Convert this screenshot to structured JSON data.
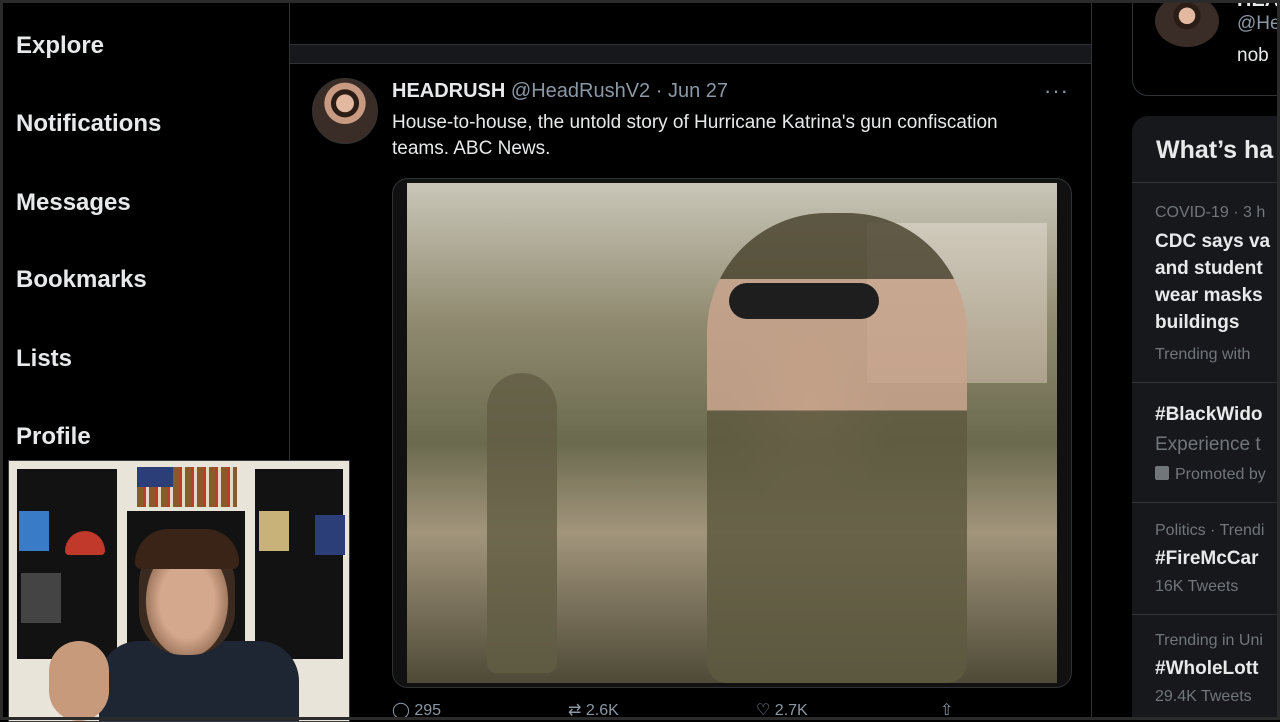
{
  "nav": {
    "items": [
      {
        "label": "Explore"
      },
      {
        "label": "Notifications"
      },
      {
        "label": "Messages"
      },
      {
        "label": "Bookmarks"
      },
      {
        "label": "Lists"
      },
      {
        "label": "Profile"
      }
    ]
  },
  "tweet": {
    "name": "HEADRUSH",
    "handle": "@HeadRushV2",
    "date": "· Jun 27",
    "more": "···",
    "text": "House-to-house, the untold story of Hurricane Katrina's gun confiscation teams. ABC News.",
    "actions": {
      "reply_count": "295",
      "retweet_count": "2.6K",
      "like_count": "2.7K"
    }
  },
  "right": {
    "who": {
      "name": "HEA",
      "handle": "@He",
      "bio": "nob"
    },
    "trends_title": "What’s ha",
    "trends": [
      {
        "meta": "COVID-19 · 3 h",
        "title_lines": [
          "CDC says va",
          "and student",
          "wear masks",
          "buildings"
        ],
        "sub": "Trending with"
      },
      {
        "title_lines": [
          "#BlackWido"
        ],
        "sub": "Experience t",
        "promo": "Promoted by"
      },
      {
        "meta": "Politics · Trendi",
        "title_lines": [
          "#FireMcCar"
        ],
        "sub": "16K Tweets"
      },
      {
        "meta": "Trending in Uni",
        "title_lines": [
          "#WholeLott"
        ],
        "sub": "29.4K Tweets"
      }
    ]
  }
}
